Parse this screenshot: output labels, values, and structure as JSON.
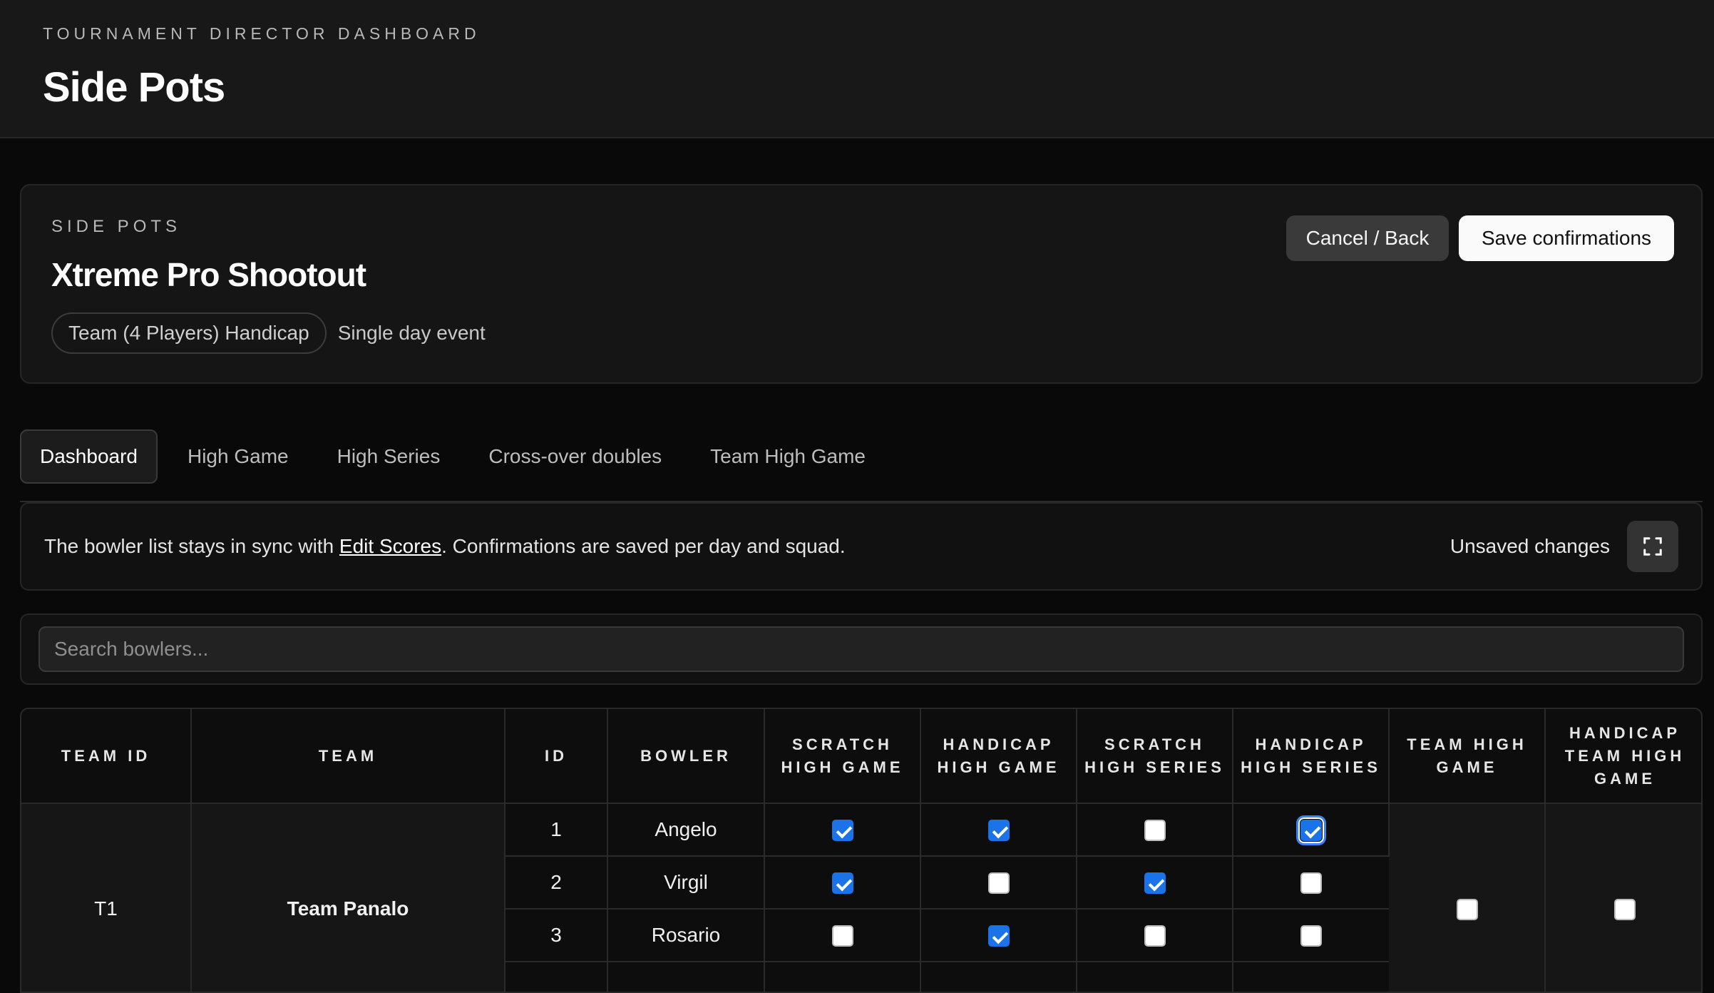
{
  "header": {
    "eyebrow": "TOURNAMENT DIRECTOR DASHBOARD",
    "title": "Side Pots"
  },
  "event": {
    "eyebrow": "SIDE POTS",
    "name": "Xtreme Pro Shootout",
    "format_pill": "Team (4 Players) Handicap",
    "duration": "Single day event",
    "back_label": "Cancel / Back",
    "save_label": "Save confirmations"
  },
  "tabs": [
    {
      "label": "Dashboard",
      "active": true
    },
    {
      "label": "High Game",
      "active": false
    },
    {
      "label": "High Series",
      "active": false
    },
    {
      "label": "Cross-over doubles",
      "active": false
    },
    {
      "label": "Team High Game",
      "active": false
    }
  ],
  "info": {
    "text_before": "The bowler list stays in sync with ",
    "link": "Edit Scores",
    "text_after": ". Confirmations are saved per day and squad.",
    "status": "Unsaved changes",
    "expand_icon": "expand-icon"
  },
  "search": {
    "placeholder": "Search bowlers...",
    "value": ""
  },
  "table": {
    "columns": [
      "TEAM ID",
      "TEAM",
      "ID",
      "BOWLER",
      "SCRATCH HIGH GAME",
      "HANDICAP HIGH GAME",
      "SCRATCH HIGH SERIES",
      "HANDICAP HIGH SERIES",
      "TEAM HIGH GAME",
      "HANDICAP TEAM HIGH GAME"
    ],
    "teams": [
      {
        "team_id": "T1",
        "team_name": "Team Panalo",
        "team_high_game": false,
        "handicap_team_high_game": false,
        "bowlers": [
          {
            "id": "1",
            "name": "Angelo",
            "scratch_high_game": true,
            "handicap_high_game": true,
            "scratch_high_series": false,
            "handicap_high_series": true
          },
          {
            "id": "2",
            "name": "Virgil",
            "scratch_high_game": true,
            "handicap_high_game": false,
            "scratch_high_series": true,
            "handicap_high_series": false
          },
          {
            "id": "3",
            "name": "Rosario",
            "scratch_high_game": false,
            "handicap_high_game": true,
            "scratch_high_series": false,
            "handicap_high_series": false
          }
        ]
      }
    ]
  }
}
